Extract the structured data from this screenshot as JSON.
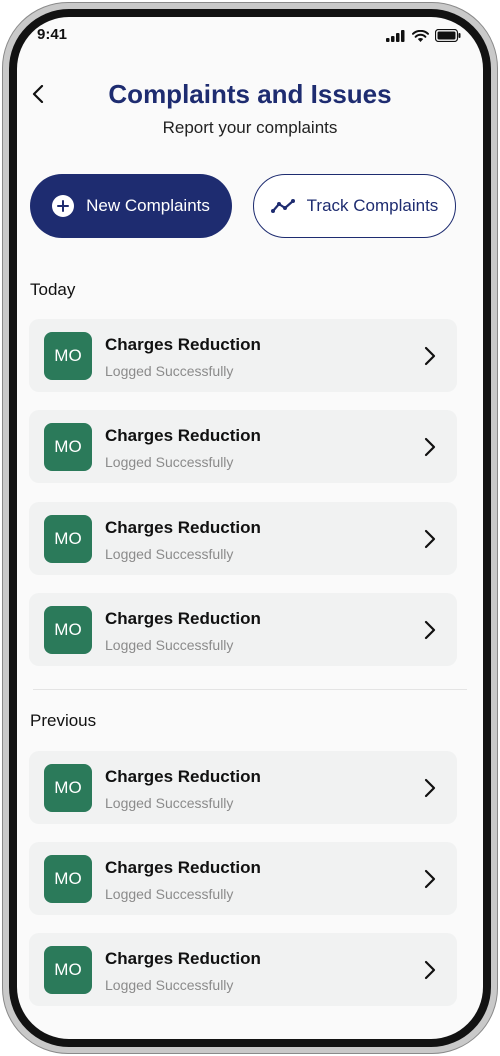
{
  "status": {
    "time": "9:41",
    "icons": [
      "signal-icon",
      "wifi-icon",
      "battery-icon"
    ]
  },
  "header": {
    "back_icon": "chevron-left-icon",
    "title": "Complaints and Issues",
    "subtitle": "Report your complaints"
  },
  "actions": {
    "new_label": "New Complaints",
    "new_icon": "plus-circle-icon",
    "track_label": "Track Complaints",
    "track_icon": "trend-line-icon"
  },
  "sections": [
    {
      "label": "Today",
      "items": [
        {
          "avatar": "MO",
          "title": "Charges Reduction",
          "status": "Logged Successfully"
        },
        {
          "avatar": "MO",
          "title": "Charges Reduction",
          "status": "Logged Successfully"
        },
        {
          "avatar": "MO",
          "title": "Charges Reduction",
          "status": "Logged Successfully"
        },
        {
          "avatar": "MO",
          "title": "Charges Reduction",
          "status": "Logged Successfully"
        }
      ]
    },
    {
      "label": "Previous",
      "items": [
        {
          "avatar": "MO",
          "title": "Charges Reduction",
          "status": "Logged Successfully"
        },
        {
          "avatar": "MO",
          "title": "Charges Reduction",
          "status": "Logged Successfully"
        },
        {
          "avatar": "MO",
          "title": "Charges Reduction",
          "status": "Logged Successfully"
        }
      ]
    }
  ],
  "colors": {
    "primary": "#1e2c70",
    "avatar_bg": "#2b7a5a",
    "card_bg": "#f1f2f2",
    "muted_text": "#8b8b8b"
  }
}
